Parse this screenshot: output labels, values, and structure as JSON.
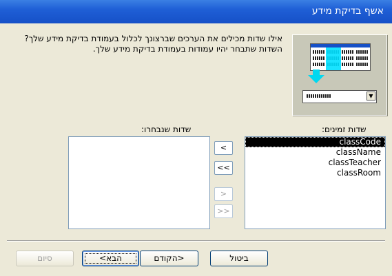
{
  "window": {
    "title": "אשף בדיקת מידע"
  },
  "wizard": {
    "instructions": "אילו שדות מכילים את הערכים שברצונך לכלול בעמודת בדיקת מידע שלך? השדות שתבחר יהיו עמודות בעמודת בדיקת מידע שלך."
  },
  "available": {
    "label": "שדות זמינים:",
    "items": [
      "classCode",
      "className",
      "classTeacher",
      "classRoom"
    ],
    "selected_index": 0
  },
  "selected_fields": {
    "label": "שדות שנבחרו:",
    "items": []
  },
  "movers": {
    "add_one": "<",
    "add_all": "<<",
    "remove_one": ">",
    "remove_all": ">>"
  },
  "buttons": {
    "cancel": "ביטול",
    "back": "<הקודם",
    "next": "הבא>",
    "finish": "סיום"
  }
}
